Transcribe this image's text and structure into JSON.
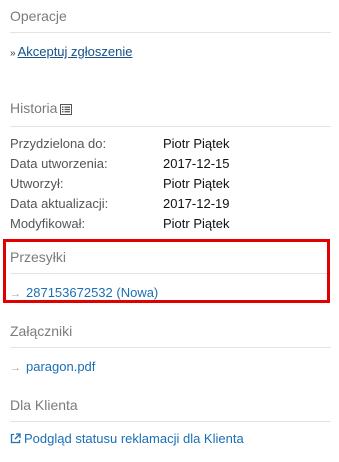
{
  "operations": {
    "title": "Operacje",
    "accept_link": "Akceptuj zgłoszenie",
    "accept_icon": "double-arrow-icon"
  },
  "history": {
    "title": "Historia",
    "icon": "list-icon",
    "rows": [
      {
        "label": "Przydzielona do:",
        "value": "Piotr Piątek"
      },
      {
        "label": "Data utworzenia:",
        "value": "2017-12-15"
      },
      {
        "label": "Utworzył:",
        "value": "Piotr Piątek"
      },
      {
        "label": "Data aktualizacji:",
        "value": "2017-12-19"
      },
      {
        "label": "Modyfikował:",
        "value": "Piotr Piątek"
      }
    ]
  },
  "shipments": {
    "title": "Przesyłki",
    "item": "287153672532 (Nowa)",
    "highlight_color": "#e00000"
  },
  "attachments": {
    "title": "Załączniki",
    "item": "paragon.pdf"
  },
  "client": {
    "title": "Dla Klienta",
    "link": "Podgląd statusu reklamacji dla Klienta",
    "link_icon": "external-link-icon"
  },
  "colors": {
    "link": "#1a6fb5",
    "muted": "#7b7b7b"
  }
}
